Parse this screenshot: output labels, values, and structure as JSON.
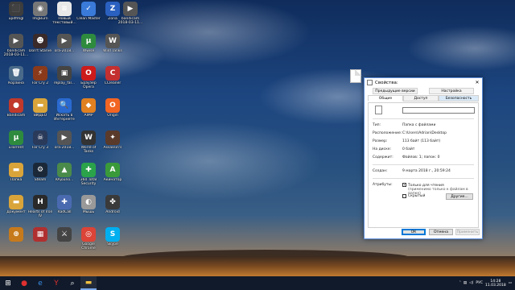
{
  "desktop_icons": [
    {
      "col": 0,
      "row": 0,
      "label": "updfmgl",
      "glyph": "⬛",
      "color": "#3d3d3d"
    },
    {
      "col": 0,
      "row": 1,
      "label": "bandicam 2018-03-11...",
      "glyph": "▶",
      "color": "#555555"
    },
    {
      "col": 0,
      "row": 2,
      "label": "Корзина",
      "glyph": "🗑",
      "color": "#4a6a8a"
    },
    {
      "col": 0,
      "row": 3,
      "label": "Bandicam",
      "glyph": "●",
      "color": "#c0392b"
    },
    {
      "col": 0,
      "row": 4,
      "label": "uTorrent",
      "glyph": "µ",
      "color": "#2e8b3e"
    },
    {
      "col": 0,
      "row": 5,
      "label": "Папка",
      "glyph": "▬",
      "color": "#d9a43a"
    },
    {
      "col": 0,
      "row": 6,
      "label": "Документ",
      "glyph": "▬",
      "color": "#d9a43a"
    },
    {
      "col": 0,
      "row": 7,
      "label": "",
      "glyph": "⊕",
      "color": "#c67a1c"
    },
    {
      "col": 1,
      "row": 0,
      "label": "ImgBurn",
      "glyph": "◉",
      "color": "#777777"
    },
    {
      "col": 1,
      "row": 1,
      "label": "Don't Starve",
      "glyph": "☻",
      "color": "#3a2a2a"
    },
    {
      "col": 1,
      "row": 2,
      "label": "Far Cry 2",
      "glyph": "⚡",
      "color": "#8a3a1a"
    },
    {
      "col": 1,
      "row": 3,
      "label": "ВИДЕО",
      "glyph": "▬",
      "color": "#d9a43a"
    },
    {
      "col": 1,
      "row": 4,
      "label": "Far Cry 3",
      "glyph": "☠",
      "color": "#2a3a5a"
    },
    {
      "col": 1,
      "row": 5,
      "label": "Steam",
      "glyph": "⚙",
      "color": "#1b2838"
    },
    {
      "col": 1,
      "row": 6,
      "label": "Hearts of Iron IV",
      "glyph": "H",
      "color": "#2a2a2a"
    },
    {
      "col": 1,
      "row": 7,
      "label": "",
      "glyph": "▦",
      "color": "#b03030"
    },
    {
      "col": 2,
      "row": 0,
      "label": "Новый текстовый...",
      "glyph": "≡",
      "color": "#e8e8e8"
    },
    {
      "col": 2,
      "row": 1,
      "label": "ora-2018...",
      "glyph": "▶",
      "color": "#555555"
    },
    {
      "col": 2,
      "row": 2,
      "label": "replay_fal...",
      "glyph": "▣",
      "color": "#444444"
    },
    {
      "col": 2,
      "row": 3,
      "label": "Искать в Интернете",
      "glyph": "🔍",
      "color": "#2a6ad0"
    },
    {
      "col": 2,
      "row": 4,
      "label": "ora-2018...",
      "glyph": "▶",
      "color": "#555555"
    },
    {
      "col": 2,
      "row": 5,
      "label": "RAjouno...",
      "glyph": "▲",
      "color": "#4a8a4a"
    },
    {
      "col": 2,
      "row": 6,
      "label": "RadCall",
      "glyph": "✚",
      "color": "#4a6ab0"
    },
    {
      "col": 2,
      "row": 7,
      "label": "",
      "glyph": "⚔",
      "color": "#444444"
    },
    {
      "col": 3,
      "row": 0,
      "label": "Clean Master",
      "glyph": "✓",
      "color": "#3a7ad9"
    },
    {
      "col": 3,
      "row": 1,
      "label": "Wwise",
      "glyph": "µ",
      "color": "#2e8b3e"
    },
    {
      "col": 3,
      "row": 2,
      "label": "Браузер Opera",
      "glyph": "O",
      "color": "#cc1b1b"
    },
    {
      "col": 3,
      "row": 3,
      "label": "AIMP",
      "glyph": "◆",
      "color": "#e08020"
    },
    {
      "col": 3,
      "row": 4,
      "label": "World of Tanks",
      "glyph": "W",
      "color": "#333333"
    },
    {
      "col": 3,
      "row": 5,
      "label": "360 Total Security",
      "glyph": "✚",
      "color": "#2aa34a"
    },
    {
      "col": 3,
      "row": 6,
      "label": "Мышь",
      "glyph": "◐",
      "color": "#999999"
    },
    {
      "col": 3,
      "row": 7,
      "label": "Google Chrome",
      "glyph": "◎",
      "color": "#db4437"
    },
    {
      "col": 4,
      "row": 0,
      "label": "Zona",
      "glyph": "Z",
      "color": "#2a60c0"
    },
    {
      "col": 4,
      "row": 1,
      "label": "Wild Tanks",
      "glyph": "W",
      "color": "#555555"
    },
    {
      "col": 4,
      "row": 2,
      "label": "CCleaner",
      "glyph": "C",
      "color": "#c43030"
    },
    {
      "col": 4,
      "row": 3,
      "label": "Origin",
      "glyph": "O",
      "color": "#f26522"
    },
    {
      "col": 4,
      "row": 4,
      "label": "Assassin's",
      "glyph": "✦",
      "color": "#5a3a2a"
    },
    {
      "col": 4,
      "row": 5,
      "label": "Акинатор",
      "glyph": "A",
      "color": "#3a9a3a"
    },
    {
      "col": 4,
      "row": 6,
      "label": "Android",
      "glyph": "✤",
      "color": "#3a3a3a"
    },
    {
      "col": 4,
      "row": 7,
      "label": "Skype",
      "glyph": "S",
      "color": "#00aff0"
    },
    {
      "col": 5,
      "row": 0,
      "label": "bandicam 2018-03-11...",
      "glyph": "▶",
      "color": "#555555"
    }
  ],
  "dialog": {
    "title": "Свойства:",
    "close_glyph": "✕",
    "tabs_top": [
      "Предыдущие версии",
      "Настройка"
    ],
    "tabs_bottom": [
      "Общие",
      "Доступ",
      "Безопасность"
    ],
    "name_value": "",
    "rows_a": [
      {
        "k": "Тип:",
        "v": "Папка с файлами"
      },
      {
        "k": "Расположение:",
        "v": "C:\\Users\\Adrian\\Desktop"
      },
      {
        "k": "Размер:",
        "v": "113 байт (113 байт)"
      },
      {
        "k": "На диске:",
        "v": "0 байт"
      },
      {
        "k": "Содержит:",
        "v": "Файлов: 1; папок: 0"
      }
    ],
    "created_k": "Создан:",
    "created_v": "9 марта 2018 г., 20:59:24",
    "attrs_k": "Атрибуты:",
    "readonly_label": "Только для чтения",
    "readonly_sub": "(применимо только к файлам в папке)",
    "hidden_label": "Скрытый",
    "other_button": "Другие...",
    "ok": "ОК",
    "cancel": "Отмена",
    "apply": "Применить"
  },
  "taskbar": {
    "items": [
      {
        "name": "start-button",
        "glyph": "⊞",
        "color": "#ffffff"
      },
      {
        "name": "taskbar-record-icon",
        "glyph": "●",
        "color": "#e03030"
      },
      {
        "name": "taskbar-ie-icon",
        "glyph": "e",
        "color": "#3a8ee6"
      },
      {
        "name": "taskbar-yandex-icon",
        "glyph": "Y",
        "color": "#e03030"
      },
      {
        "name": "taskbar-search-icon",
        "glyph": "⌕",
        "color": "#ffffff"
      },
      {
        "name": "taskbar-explorer-icon",
        "glyph": "▬",
        "color": "#f0c040"
      }
    ],
    "lang": "РУС",
    "time": "14:28",
    "date": "11.03.2018"
  }
}
